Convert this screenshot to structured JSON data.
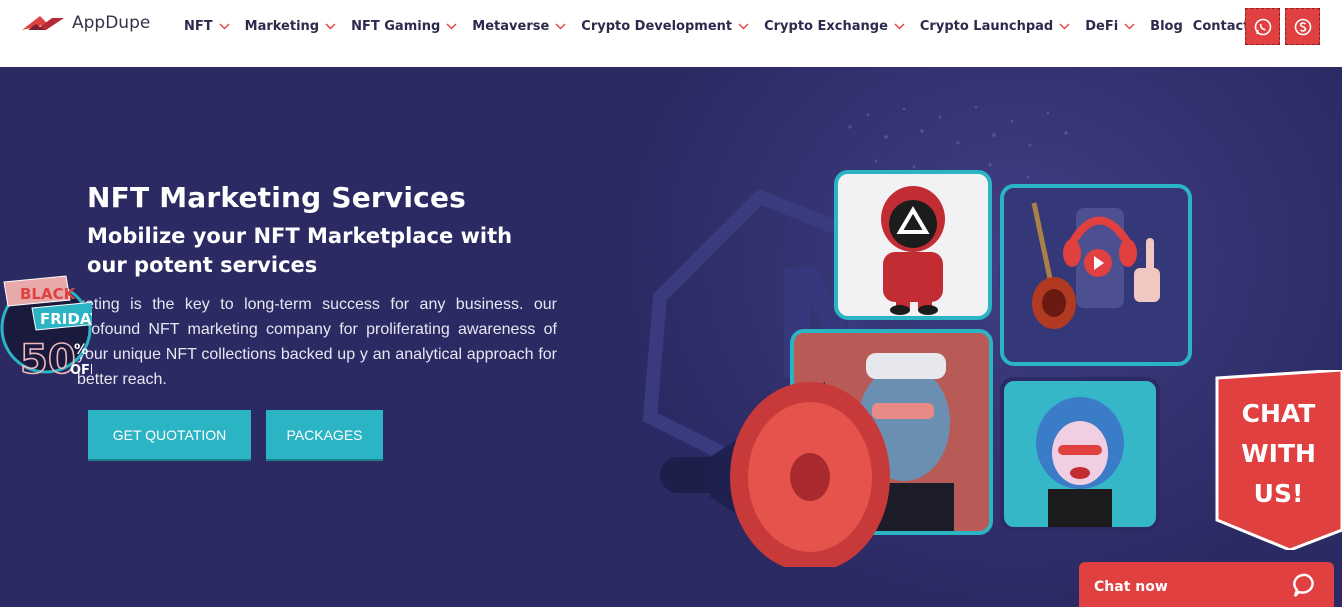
{
  "brand": {
    "name": "AppDupe"
  },
  "nav": {
    "items": [
      {
        "label": "NFT",
        "dropdown": true
      },
      {
        "label": "Marketing",
        "dropdown": true
      },
      {
        "label": "NFT Gaming",
        "dropdown": true
      },
      {
        "label": "Metaverse",
        "dropdown": true
      },
      {
        "label": "Crypto Development",
        "dropdown": true
      },
      {
        "label": "Crypto Exchange",
        "dropdown": true
      },
      {
        "label": "Crypto Launchpad",
        "dropdown": true
      },
      {
        "label": "DeFi",
        "dropdown": true
      },
      {
        "label": "Blog",
        "dropdown": false
      },
      {
        "label": "Contact",
        "dropdown": true
      }
    ],
    "social_icons": [
      "whatsapp-icon",
      "skype-icon"
    ]
  },
  "hero": {
    "title": "NFT Marketing Services",
    "subtitle": "Mobilize your NFT Marketplace with our potent services",
    "description": "keting is the key to long-term success for any business. our profound NFT marketing company for proliferating awareness of your unique NFT collections backed up y an analytical approach for better reach.",
    "buttons": {
      "quote": "GET QUOTATION",
      "packages": "PACKAGES"
    },
    "art_text": "NFT"
  },
  "badge": {
    "line1": "BLACK",
    "line2": "FRIDAY",
    "percent": "50",
    "symbol": "%",
    "off": "OFF"
  },
  "chat_ribbon": {
    "line1": "CHAT",
    "line2": "WITH",
    "line3": "US!"
  },
  "chat_bar": {
    "label": "Chat now"
  },
  "colors": {
    "brand_red": "#e0403f",
    "hero_bg": "#2b2a63",
    "teal": "#2bb4c4",
    "nav_text": "#2d2b4d"
  }
}
